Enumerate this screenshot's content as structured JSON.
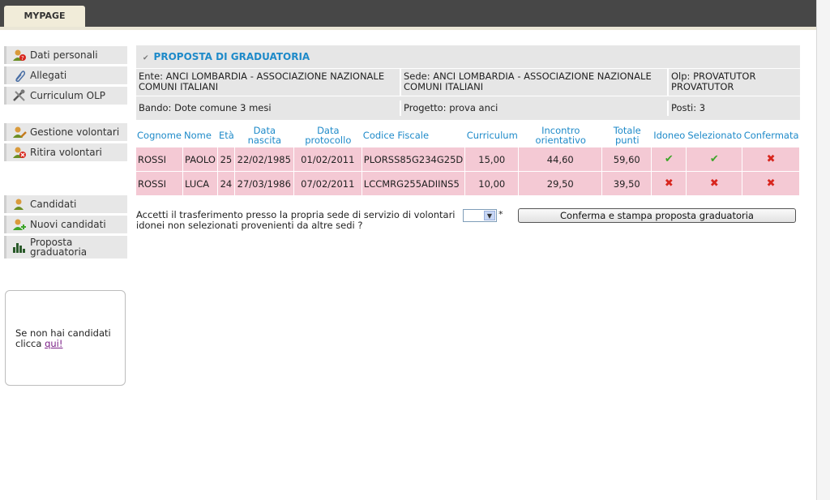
{
  "header": {
    "tab_label": "MYPAGE"
  },
  "sidebar": {
    "group1": [
      {
        "label": "Dati personali",
        "icon": "user-question-icon"
      },
      {
        "label": "Allegati",
        "icon": "paperclip-icon"
      },
      {
        "label": "Curriculum OLP",
        "icon": "tools-icon"
      }
    ],
    "group2": [
      {
        "label": "Gestione volontari",
        "icon": "user-edit-icon"
      },
      {
        "label": "Ritira volontari",
        "icon": "user-remove-icon"
      }
    ],
    "group3": [
      {
        "label": "Candidati",
        "icon": "user-icon"
      },
      {
        "label": "Nuovi candidati",
        "icon": "user-add-icon"
      },
      {
        "label": "Proposta graduatoria",
        "icon": "bar-chart-icon"
      }
    ]
  },
  "help_box": {
    "text": "Se non hai candidati clicca ",
    "link": "qui!"
  },
  "panel": {
    "title": "PROPOSTA DI GRADUATORIA",
    "ente": "Ente: ANCI LOMBARDIA - ASSOCIAZIONE NAZIONALE COMUNI ITALIANI",
    "sede": "Sede: ANCI LOMBARDIA - ASSOCIAZIONE NAZIONALE COMUNI ITALIANI",
    "olp": "Olp: PROVATUTOR PROVATUTOR",
    "bando": "Bando: Dote comune 3 mesi",
    "progetto": "Progetto: prova anci",
    "posti": "Posti: 3"
  },
  "table": {
    "headers": [
      "Cognome",
      "Nome",
      "Età",
      "Data nascita",
      "Data protocollo",
      "Codice Fiscale",
      "Curriculum",
      "Incontro orientativo",
      "Totale punti",
      "Idoneo",
      "Selezionato",
      "Confermata"
    ],
    "rows": [
      {
        "cognome": "ROSSI",
        "nome": "PAOLO",
        "eta": "25",
        "nascita": "22/02/1985",
        "protocollo": "01/02/2011",
        "cf": "PLORSS85G234G25D",
        "curriculum": "15,00",
        "incontro": "44,60",
        "totale": "59,60",
        "idoneo": "check-icon",
        "selezionato": "check-icon",
        "confermata": "cross-icon"
      },
      {
        "cognome": "ROSSI",
        "nome": "LUCA",
        "eta": "24",
        "nascita": "27/03/1986",
        "protocollo": "07/02/2011",
        "cf": "LCCMRG255ADIINS5",
        "curriculum": "10,00",
        "incontro": "29,50",
        "totale": "39,50",
        "idoneo": "cross-icon",
        "selezionato": "cross-icon",
        "confermata": "cross-icon"
      }
    ]
  },
  "transfer": {
    "question": "Accetti il trasferimento presso la propria sede di servizio di volontari idonei non selezionati provenienti da altre sedi ?",
    "select_value": "",
    "required_mark": "*",
    "confirm_label": "Conferma e stampa proposta graduatoria"
  },
  "colors": {
    "accent": "#1e8ac9",
    "row_bg": "#f4c9d4",
    "topbar": "#474747",
    "ok": "#3ea52a",
    "no": "#d8261e"
  }
}
